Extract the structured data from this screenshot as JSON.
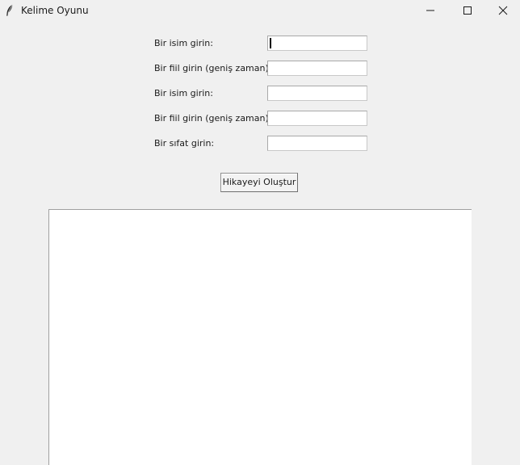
{
  "window": {
    "title": "Kelime Oyunu",
    "icon": "feather-icon",
    "controls": [
      "minimize-icon",
      "maximize-icon",
      "close-icon"
    ]
  },
  "form": {
    "fields": [
      {
        "label": "Bir isim girin:",
        "value": "",
        "focused": true
      },
      {
        "label": "Bir fiil girin (geniş zaman):",
        "value": ""
      },
      {
        "label": "Bir isim girin:",
        "value": ""
      },
      {
        "label": "Bir fiil girin (geniş zaman):",
        "value": ""
      },
      {
        "label": "Bir sıfat girin:",
        "value": ""
      }
    ],
    "submit_label": "Hikayeyi Oluştur"
  },
  "output": {
    "story_text": ""
  }
}
